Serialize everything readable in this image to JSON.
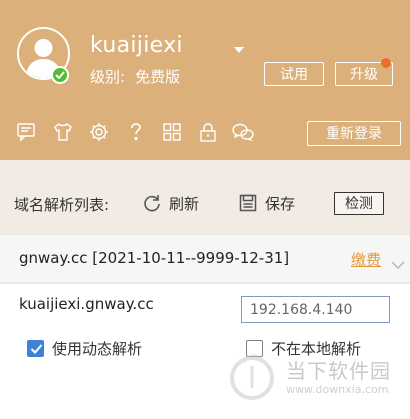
{
  "colors": {
    "header_bg": "#dbb07b",
    "accent_orange": "#e39a3c",
    "online_green": "#4fbf2a",
    "checkbox_blue": "#3f82d3"
  },
  "user": {
    "name": "kuaijiexi",
    "level_label": "级别:",
    "level_value": "免费版",
    "trial_button": "试用",
    "upgrade_button": "升级",
    "relogin_button": "重新登录"
  },
  "toolbar_icons": [
    "message-icon",
    "tshirt-icon",
    "gear-icon",
    "help-icon",
    "grid-icon",
    "lock-icon",
    "wechat-icon"
  ],
  "domain_list": {
    "title": "域名解析列表:",
    "refresh_label": "刷新",
    "save_label": "保存",
    "check_label": "检测"
  },
  "domain": {
    "name": "gnway.cc [2021-10-11--9999-12-31]",
    "pay_link": "缴费"
  },
  "record": {
    "host": "kuaijiexi.gnway.cc",
    "ip": "192.168.4.140",
    "dynamic_label": "使用动态解析",
    "dynamic_checked": true,
    "local_label": "不在本地解析",
    "local_checked": false
  },
  "watermark": {
    "text": "当下软件园",
    "url": "www.downxia.com"
  }
}
